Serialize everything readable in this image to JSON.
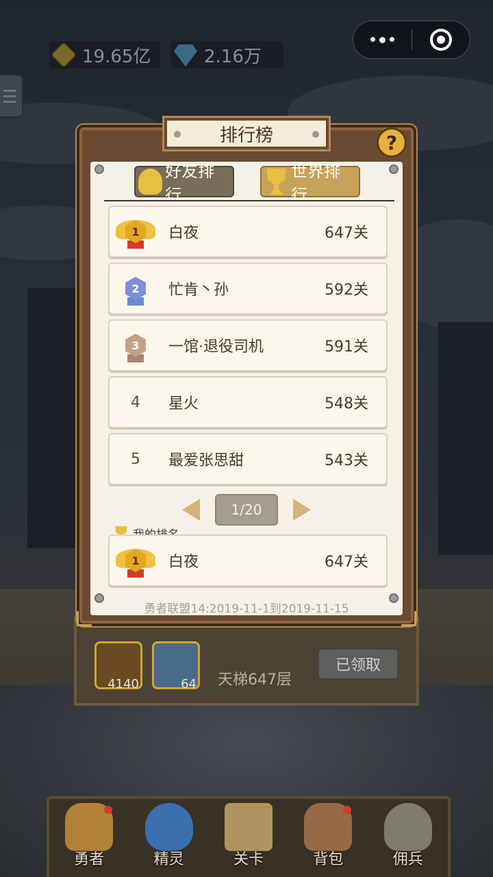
{
  "currency": {
    "gold": "19.65亿",
    "gems": "2.16万",
    "gold_icon": "gold-coin-icon",
    "gem_icon": "diamond-icon"
  },
  "colors": {
    "panel_wood": "#6a4a30",
    "panel_paper": "#f6f1e6",
    "tab_active": "#c7a25a",
    "tab_inactive": "#776d5a",
    "gold_medal": "#e2a820",
    "silver_medal": "#7f8ed8",
    "bronze_medal": "#c4a08c"
  },
  "leaderboard": {
    "title": "排行榜",
    "help_label": "?",
    "tabs": [
      {
        "label": "好友排行",
        "icon": "friends-icon",
        "active": false
      },
      {
        "label": "世界排行",
        "icon": "trophy-icon",
        "active": true
      }
    ],
    "rows": [
      {
        "rank": "1",
        "medal": "gold",
        "name": "白夜",
        "score": "647关"
      },
      {
        "rank": "2",
        "medal": "silver",
        "name": "忙肯丶孙",
        "score": "592关"
      },
      {
        "rank": "3",
        "medal": "bronze",
        "name": "一馆·退役司机",
        "score": "591关"
      },
      {
        "rank": "4",
        "medal": "",
        "name": "星火",
        "score": "548关"
      },
      {
        "rank": "5",
        "medal": "",
        "name": "最爱张思甜",
        "score": "543关"
      }
    ],
    "pager": {
      "page": "1/20"
    },
    "my_rank_label": "我的排名",
    "my_rank": {
      "rank": "1",
      "medal": "gold",
      "name": "白夜",
      "score": "647关"
    },
    "period": "勇者联盟14:2019-11-1到2019-11-15"
  },
  "reward": {
    "items": [
      {
        "icon": "diamond-chest-icon",
        "count": "4140"
      },
      {
        "icon": "skill-book-icon",
        "count": "64"
      }
    ],
    "ladder": "天梯647层",
    "claimed_label": "已领取"
  },
  "nav": [
    {
      "label": "勇者",
      "icon": "hero-icon",
      "badge": true
    },
    {
      "label": "精灵",
      "icon": "spirit-icon",
      "badge": false
    },
    {
      "label": "关卡",
      "icon": "map-scroll-icon",
      "badge": false
    },
    {
      "label": "背包",
      "icon": "backpack-icon",
      "badge": true
    },
    {
      "label": "佣兵",
      "icon": "mercenary-icon",
      "badge": false
    }
  ]
}
